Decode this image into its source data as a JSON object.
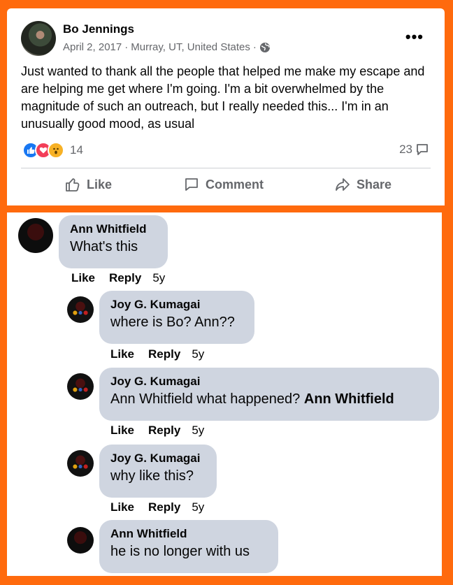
{
  "post": {
    "author": "Bo Jennings",
    "date": "April 2, 2017",
    "location": "Murray, UT, United States",
    "separator": "·",
    "text": "Just wanted to thank all the people that helped me make my escape and are helping me get where I'm going. I'm a bit overwhelmed by the magnitude of such an outreach, but I really needed this... I'm in an unusually good mood,  as usual",
    "reaction_count": "14",
    "comment_count": "23",
    "more_label": "•••",
    "actions": {
      "like": "Like",
      "comment": "Comment",
      "share": "Share"
    }
  },
  "comments": [
    {
      "author": "Ann Whitfield",
      "text": "What's this",
      "like": "Like",
      "reply": "Reply",
      "time": "5y"
    },
    {
      "author": "Joy G. Kumagai",
      "text": "where is Bo? Ann??",
      "like": "Like",
      "reply": "Reply",
      "time": "5y"
    },
    {
      "author": "Joy G. Kumagai",
      "text": "Ann Whitfield what happened?",
      "mention": "Ann Whitfield",
      "like": "Like",
      "reply": "Reply",
      "time": "5y"
    },
    {
      "author": "Joy G. Kumagai",
      "text": "why like this?",
      "like": "Like",
      "reply": "Reply",
      "time": "5y"
    },
    {
      "author": "Ann Whitfield",
      "text": "he is no longer with us"
    }
  ],
  "colors": {
    "frame": "#ff6a0d",
    "bubble": "#cfd5e0",
    "like_blue": "#1877f2"
  }
}
